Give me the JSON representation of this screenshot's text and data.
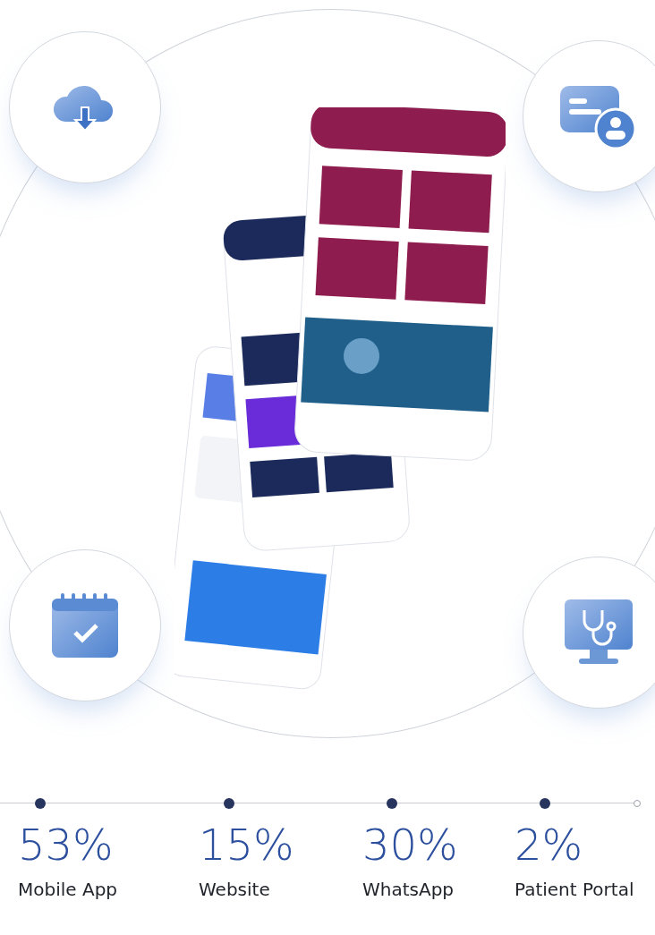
{
  "stats": [
    {
      "value": "53%",
      "label": "Mobile App"
    },
    {
      "value": "15%",
      "label": "Website"
    },
    {
      "value": "30%",
      "label": "WhatsApp"
    },
    {
      "value": "2%",
      "label": "Patient Portal"
    }
  ]
}
